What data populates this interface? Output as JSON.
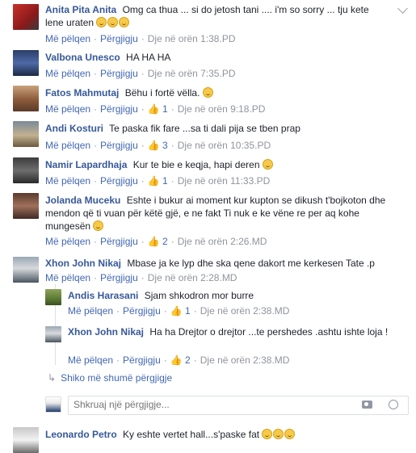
{
  "actions": {
    "like": "Më pëlqen",
    "reply": "Përgjigju",
    "sep": "·"
  },
  "comments": [
    {
      "author": "Anita Pita Anita",
      "text": "Omg ca thua ... si do jetosh tani .... i'm so sorry ... tju kete lene uraten",
      "time": "Dje në orën 1:38.PD",
      "likes": ""
    },
    {
      "author": "Valbona Unesco",
      "text": "HA HA HA",
      "time": "Dje në orën 7:35.PD",
      "likes": ""
    },
    {
      "author": "Fatos Mahmutaj",
      "text": "Bëhu i fortë vëlla.",
      "time": "Dje në orën 9:18.PD",
      "likes": "1"
    },
    {
      "author": "Andi Kosturi",
      "text": "Te paska fik fare ...sa ti dali pija se tben prap",
      "time": "Dje në orën 10:35.PD",
      "likes": "3"
    },
    {
      "author": "Namir Lapardhaja",
      "text": "Kur te bie e keqja, hapi deren",
      "time": "Dje në orën 11:33.PD",
      "likes": "1"
    },
    {
      "author": "Jolanda Muceku",
      "text": "Eshte i bukur ai moment kur kupton se dikush t'bojkoton dhe mendon që ti vuan për këtë gjë, e ne fakt Ti nuk e ke vëne re per aq kohe mungesën",
      "time": "Dje në orën 2:26.MD",
      "likes": "2"
    },
    {
      "author": "Xhon John Nikaj",
      "text": "Mbase ja ke lyp dhe ska qene dakort me kerkesen Tate .p",
      "time": "Dje në orën 2:28.MD",
      "likes": ""
    }
  ],
  "replies": [
    {
      "author": "Andis Harasani",
      "text": "Sjam shkodron mor burre",
      "time": "Dje në orën 2:38.MD",
      "likes": "1"
    },
    {
      "author": "Xhon John Nikaj",
      "text": "Ha ha Drejtor o drejtor ...te pershedes .ashtu ishte loja !",
      "time": "Dje në orën 2:38.MD",
      "likes": "2"
    }
  ],
  "more_replies": "Shiko më shumë përgjigje",
  "reply_input": {
    "placeholder": "Shkruaj një përgjigje..."
  },
  "last_comment": {
    "author": "Leonardo Petro",
    "text": "Ky eshte vertet hall...s'paske fat"
  }
}
